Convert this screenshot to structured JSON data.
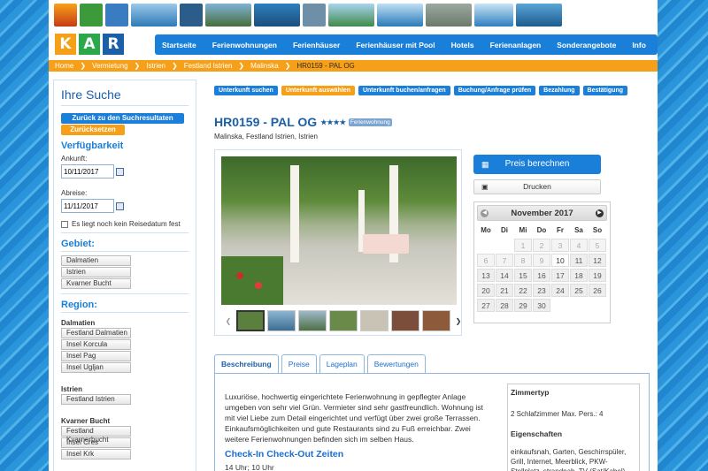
{
  "header": {
    "logo_letters": [
      "K",
      "A",
      "R"
    ],
    "nav": [
      "Startseite",
      "Ferienwohnungen",
      "Ferienhäuser",
      "Ferienhäuser mit Pool",
      "Hotels",
      "Ferienanlagen",
      "Sonderangebote",
      "Info"
    ]
  },
  "breadcrumb": {
    "items": [
      "Home",
      "Vermietung",
      "Istrien",
      "Festland Istrien",
      "Malinska"
    ],
    "current": "HR0159 - PAL OG"
  },
  "sidebar": {
    "title": "Ihre Suche",
    "back_label": "Zurück zu den Suchresultaten",
    "reset_label": "Zurücksetzen",
    "availability_heading": "Verfügbarkeit",
    "arrival_label": "Ankunft:",
    "arrival_value": "10/11/2017",
    "departure_label": "Abreise:",
    "departure_value": "11/11/2017",
    "no_date_label": "Es liegt noch kein Reisedatum fest",
    "area_heading": "Gebiet:",
    "areas": [
      "Dalmatien",
      "Istrien",
      "Kvarner Bucht"
    ],
    "region_heading": "Region:",
    "groups": [
      {
        "name": "Dalmatien",
        "items": [
          "Festland Dalmatien",
          "Insel Korcula",
          "Insel Pag",
          "Insel Ugljan"
        ]
      },
      {
        "name": "Istrien",
        "items": [
          "Festland Istrien"
        ]
      },
      {
        "name": "Kvarner Bucht",
        "items": [
          "Festland Kvarnerbucht",
          "Insel Cres",
          "Insel Krk"
        ]
      }
    ]
  },
  "steps": [
    "Unterkunft suchen",
    "Unterkunft auswählen",
    "Unterkunft buchen/anfragen",
    "Buchung/Anfrage prüfen",
    "Bezahlung",
    "Bestätigung"
  ],
  "steps_active_index": 1,
  "property": {
    "title": "HR0159 - PAL OG",
    "stars": "★★★★",
    "type_badge": "Ferienwohnung",
    "location": "Malinska, Festland Istrien, Istrien"
  },
  "actions": {
    "price_label": "Preis berechnen",
    "print_label": "Drucken"
  },
  "calendar": {
    "month": "November 2017",
    "weekdays": [
      "Mo",
      "Di",
      "Mi",
      "Do",
      "Fr",
      "Sa",
      "So"
    ],
    "leading_blanks": 2,
    "days_in_month": 30,
    "past_until": 9
  },
  "tabs": [
    "Beschreibung",
    "Preise",
    "Lageplan",
    "Bewertungen"
  ],
  "description": {
    "text": "Luxuriöse, hochwertig eingerichtete Ferienwohnung in gepflegter Anlage umgeben von sehr viel Grün. Vermieter sind sehr gastfreundlich. Wohnung ist mit viel Liebe zum Detail eingerichtet und verfügt über zwei große Terrassen. Einkaufsmöglichkeiten und gute Restaurants sind zu Fuß erreichbar. Zwei weitere Ferienwohnungen befinden sich im selben Haus.",
    "checkin_heading": "Check-In Check-Out Zeiten",
    "checkin_times": "14 Uhr; 10 Uhr"
  },
  "info": {
    "room_heading": "Zimmertyp",
    "room_value": "2 Schlafzimmer Max. Pers.: 4",
    "features_heading": "Eigenschaften",
    "features_value": "einkaufsnah, Garten, Geschirrspüler, Grill, Internet, Meerblick, PKW-Stellplatz, strandnah, TV (Sat/Kabel),"
  },
  "colors": {
    "primary": "#1a7fd8",
    "accent": "#f6a019",
    "logo": [
      "#f6a019",
      "#2aa84a",
      "#1a5fa8"
    ]
  }
}
